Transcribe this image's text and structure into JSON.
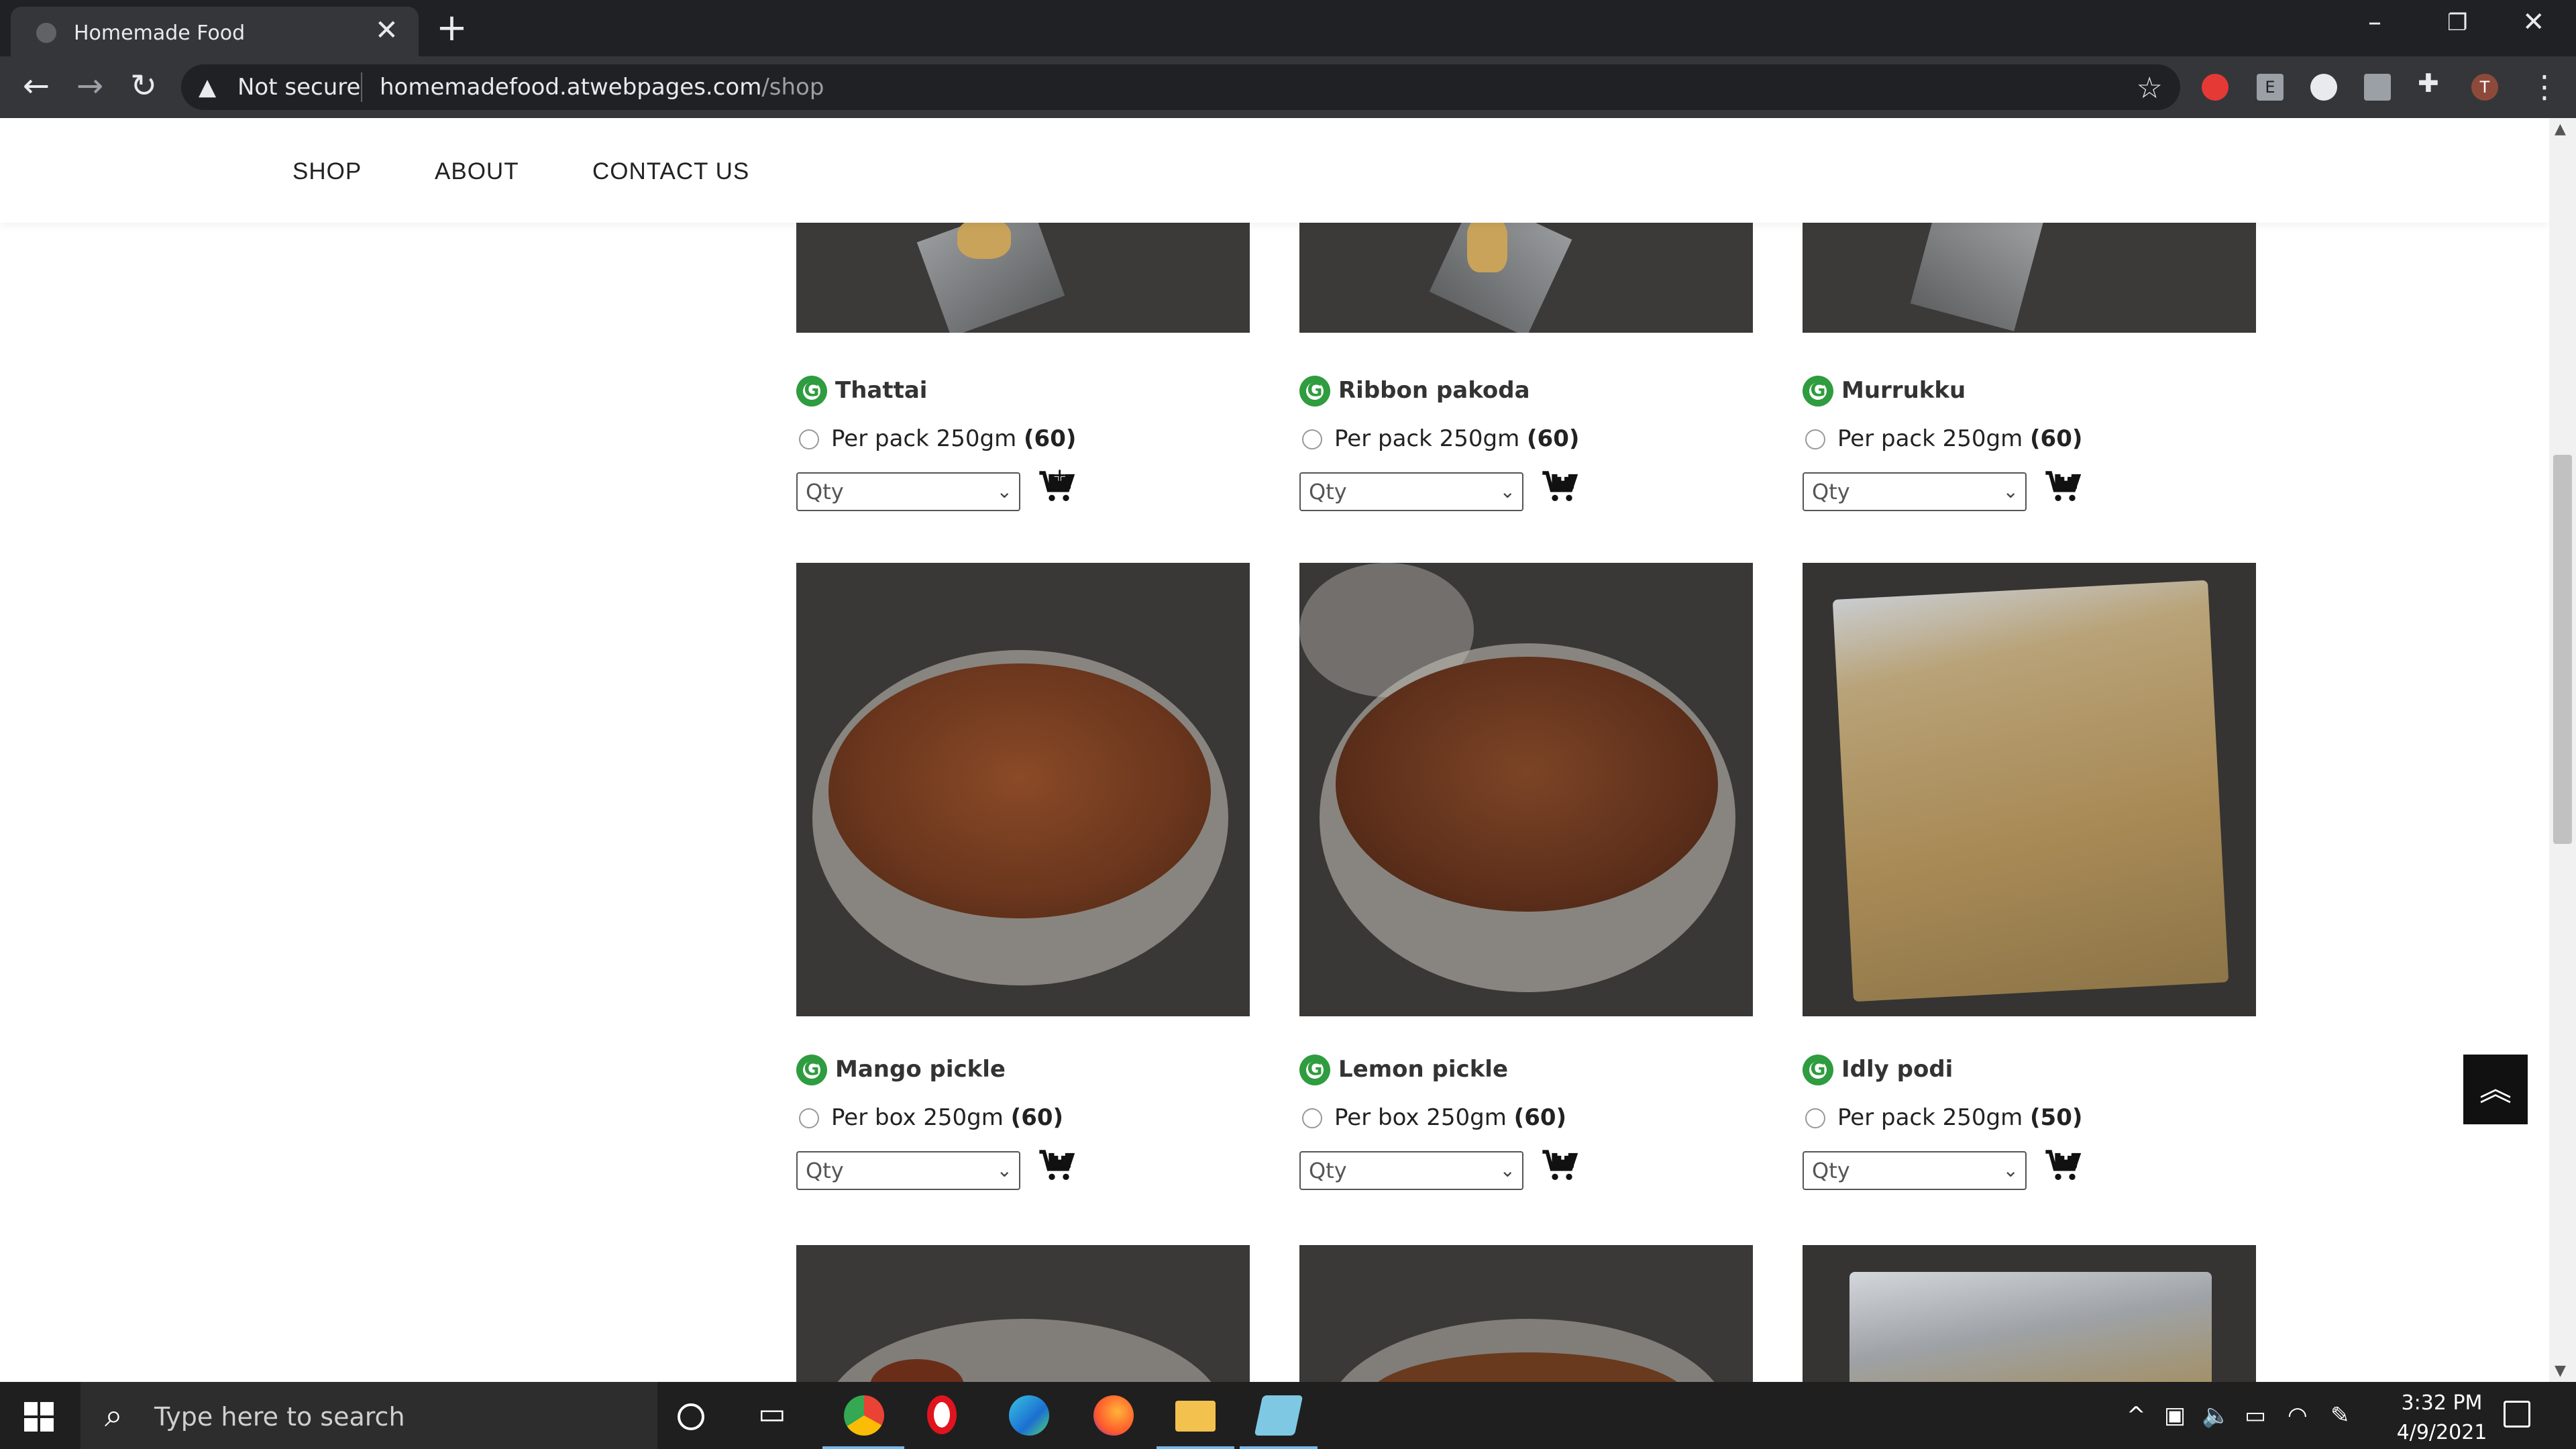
{
  "browser": {
    "tab_title": "Homemade Food",
    "tab_close": "✕",
    "new_tab": "+",
    "security_label": "Not secure",
    "url_host": "homemadefood.atwebpages.com",
    "url_path": "/shop",
    "profile_initial": "T",
    "ext_e_label": "E"
  },
  "site_nav": {
    "items": [
      "SHOP",
      "ABOUT",
      "CONTACT US"
    ]
  },
  "products": [
    {
      "name": "Thattai",
      "variant": "Per pack 250gm",
      "price": "(60)",
      "qty_placeholder": "Qty"
    },
    {
      "name": "Ribbon pakoda",
      "variant": "Per pack 250gm",
      "price": "(60)",
      "qty_placeholder": "Qty"
    },
    {
      "name": "Murrukku",
      "variant": "Per pack 250gm",
      "price": "(60)",
      "qty_placeholder": "Qty"
    },
    {
      "name": "Mango pickle",
      "variant": "Per box 250gm",
      "price": "(60)",
      "qty_placeholder": "Qty"
    },
    {
      "name": "Lemon pickle",
      "variant": "Per box 250gm",
      "price": "(60)",
      "qty_placeholder": "Qty"
    },
    {
      "name": "Idly podi",
      "variant": "Per pack 250gm",
      "price": "(50)",
      "qty_placeholder": "Qty"
    }
  ],
  "taskbar": {
    "search_placeholder": "Type here to search",
    "time": "3:32 PM",
    "date": "4/9/2021"
  },
  "colors": {
    "tabbar": "#202124",
    "toolbar": "#35363a",
    "brand_green": "#2e9c3f",
    "taskbar": "#1f1f1f"
  },
  "icons": [
    "back-arrow-icon",
    "forward-arrow-icon",
    "reload-icon",
    "warning-icon",
    "star-icon",
    "extensions-icon",
    "cart-add-icon",
    "chevron-up-icon",
    "windows-icon",
    "search-icon"
  ]
}
